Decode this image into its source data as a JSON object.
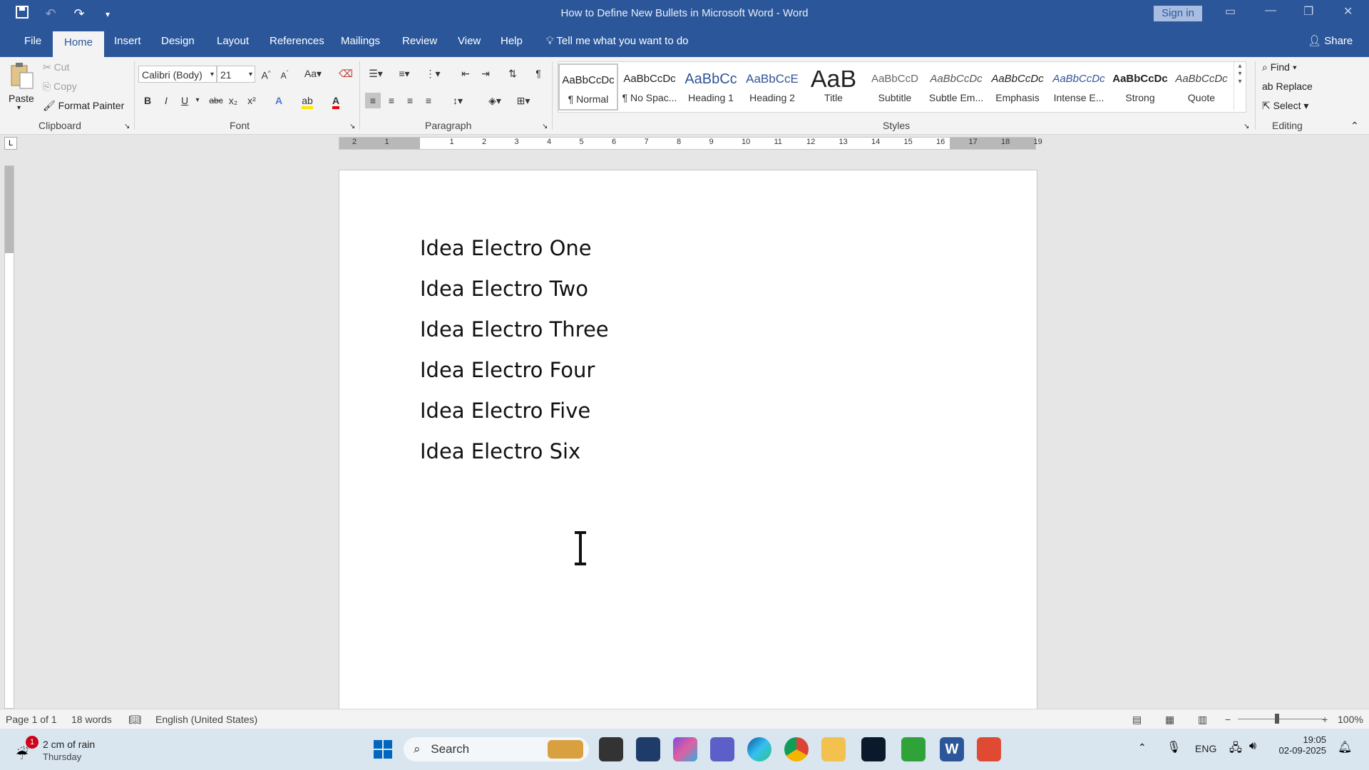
{
  "window": {
    "title": "How to Define New Bullets in Microsoft Word  -  Word",
    "sign_in": "Sign in"
  },
  "qat": {
    "save_icon": "save-icon",
    "undo_icon": "undo-icon",
    "redo_icon": "redo-icon",
    "customize_icon": "customize-qat-icon"
  },
  "tabs": [
    {
      "label": "File"
    },
    {
      "label": "Home"
    },
    {
      "label": "Insert"
    },
    {
      "label": "Design"
    },
    {
      "label": "Layout"
    },
    {
      "label": "References"
    },
    {
      "label": "Mailings"
    },
    {
      "label": "Review"
    },
    {
      "label": "View"
    },
    {
      "label": "Help"
    }
  ],
  "tell_me": "Tell me what you want to do",
  "share": "Share",
  "clipboard": {
    "paste": "Paste",
    "cut": "Cut",
    "copy": "Copy",
    "format_painter": "Format Painter",
    "label": "Clipboard"
  },
  "font": {
    "name": "Calibri (Body)",
    "size": "21",
    "label": "Font",
    "bold": "B",
    "italic": "I",
    "underline": "U",
    "strike": "abc",
    "sub": "x₂",
    "sup": "x²",
    "change_case": "Aa"
  },
  "paragraph": {
    "label": "Paragraph"
  },
  "styles": {
    "label": "Styles",
    "items": [
      {
        "sample": "AaBbCcDc",
        "name": "¶ Normal"
      },
      {
        "sample": "AaBbCcDc",
        "name": "¶ No Spac..."
      },
      {
        "sample": "AaBbCc",
        "name": "Heading 1"
      },
      {
        "sample": "AaBbCcE",
        "name": "Heading 2"
      },
      {
        "sample": "AaB",
        "name": "Title"
      },
      {
        "sample": "AaBbCcD",
        "name": "Subtitle"
      },
      {
        "sample": "AaBbCcDc",
        "name": "Subtle Em..."
      },
      {
        "sample": "AaBbCcDc",
        "name": "Emphasis"
      },
      {
        "sample": "AaBbCcDc",
        "name": "Intense E..."
      },
      {
        "sample": "AaBbCcDc",
        "name": "Strong"
      },
      {
        "sample": "AaBbCcDc",
        "name": "Quote"
      }
    ]
  },
  "editing": {
    "find": "Find",
    "replace": "Replace",
    "select": "Select",
    "label": "Editing"
  },
  "ruler": {
    "numbers": [
      "2",
      "1",
      "1",
      "2",
      "3",
      "4",
      "5",
      "6",
      "7",
      "8",
      "9",
      "10",
      "11",
      "12",
      "13",
      "14",
      "15",
      "16",
      "17",
      "18",
      "19"
    ]
  },
  "document": {
    "lines": [
      "Idea Electro One",
      "Idea Electro Two",
      "Idea Electro Three",
      "Idea Electro Four",
      "Idea Electro Five",
      "Idea Electro Six"
    ]
  },
  "status": {
    "page": "Page 1 of 1",
    "words": "18 words",
    "language": "English (United States)",
    "zoom": "100%",
    "zoom_minus": "−",
    "zoom_plus": "+"
  },
  "taskbar": {
    "weather_badge": "1",
    "weather_text": "2 cm of rain",
    "weather_day": "Thursday",
    "search": "Search",
    "lang": "ENG",
    "time": "19:05",
    "date": "02-09-2025"
  },
  "colors": {
    "brand": "#2b579a",
    "ribbon": "#f3f3f3",
    "taskbar": "#d9e6f0"
  }
}
